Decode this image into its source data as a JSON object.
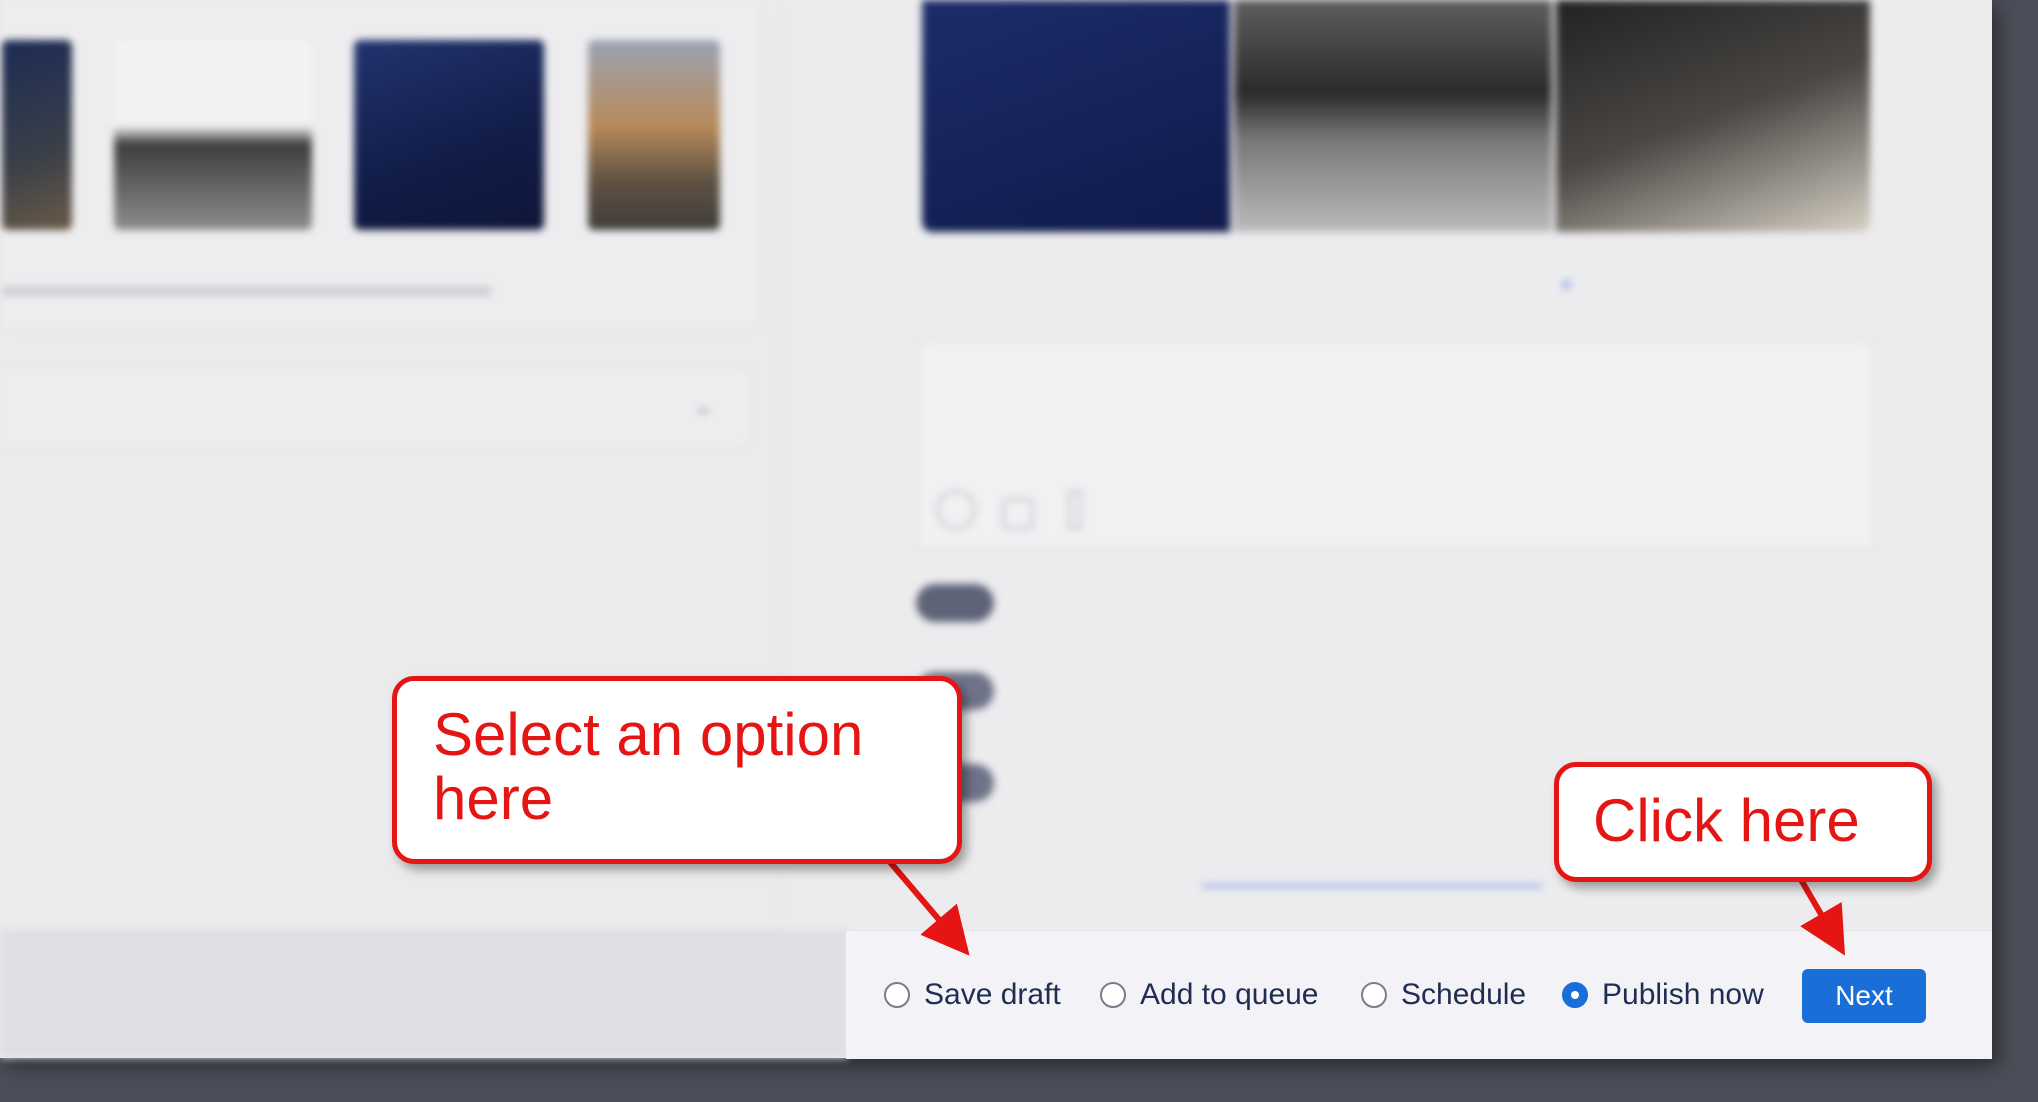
{
  "publish_options": {
    "options": [
      {
        "label": "Save draft",
        "checked": false
      },
      {
        "label": "Add to queue",
        "checked": false
      },
      {
        "label": "Schedule",
        "checked": false
      },
      {
        "label": "Publish now",
        "checked": true
      }
    ],
    "next_label": "Next"
  },
  "callouts": {
    "select_option": "Select an option here",
    "click_here": "Click here"
  },
  "colors": {
    "accent": "#1a6ed8",
    "callout_red": "#e41512",
    "backdrop": "#4b4e58"
  }
}
